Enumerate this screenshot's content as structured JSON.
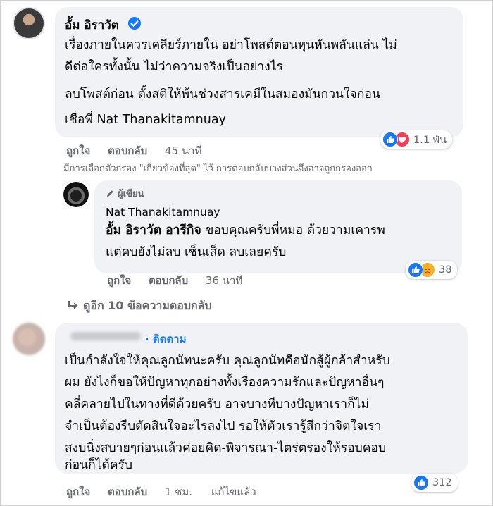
{
  "comment1": {
    "author": "อั้ม อิราวัต",
    "lines": [
      "เรื่องภายในควรเคลียร์ภายใน อย่าโพสต์ตอนหุนหันพลันแล่น ไม่",
      "ดีต่อใครทั้งนั้น ไม่ว่าความจริงเป็นอย่างไร",
      "ลบโพสต์ก่อน ตั้งสติให้พ้นช่วงสารเคมีในสมองมันกวนใจก่อน",
      "เชื่อพี่ Nat Thanakitamnuay"
    ],
    "reaction_count": "1.1 พัน",
    "like_label": "ถูกใจ",
    "reply_label": "ตอบกลับ",
    "time": "45 นาที"
  },
  "filter_notice": "มีการเลือกตัวกรอง \"เกี่ยวข้องที่สุด\" ไว้ การตอบกลับบางส่วนจึงอาจถูกกรองออก",
  "reply1": {
    "badge": "ผู้เขียน",
    "author": "Nat Thanakitamnuay",
    "mention": "อั้ม อิราวัต อารีกิจ",
    "line1_rest": " ขอบคุณครับพี่หมอ ด้วยวามเคารพ",
    "line2": "แต่คบยังไม่ลบ เซ็นเส็ด ลบเลยครับ",
    "reaction_count": "38",
    "like_label": "ถูกใจ",
    "reply_label": "ตอบกลับ",
    "time": "36 นาที"
  },
  "more_replies": "ดูอีก 10 ข้อความตอบกลับ",
  "comment2": {
    "follow_label": "· ติดตาม",
    "lines": [
      "เป็นกำลังใจให้คุณลูกนัทนะครับ คุณลูกนัทคือนักสู้ผู้กล้าสำหรับ",
      "ผม ยังไงก็ขอให้ปัญหาทุกอย่างทั้งเรื่องความรักและปัญหาอื่นๆ",
      "คลี่คลายไปในทางที่ดีด้วยครับ อาจบางทีบางปัญหาเราก็ไม่",
      "จำเป็นต้องรีบตัดสินใจอะไรลงไป รอให้ตัวเรารู้สึกว่าจิตใจเรา",
      "สงบนิ่งสบายๆก่อนแล้วค่อยคิด-พิจารณา-ไตร่ตรองให้รอบคอบ",
      "ก่อนก็ได้ครับ"
    ],
    "reaction_count": "312",
    "like_label": "ถูกใจ",
    "reply_label": "ตอบกลับ",
    "time": "1 ชม.",
    "edited": "แก้ไขแล้ว"
  },
  "colors": {
    "link": "#1877f2",
    "bubble": "#f0f2f5",
    "meta": "#65676b"
  }
}
